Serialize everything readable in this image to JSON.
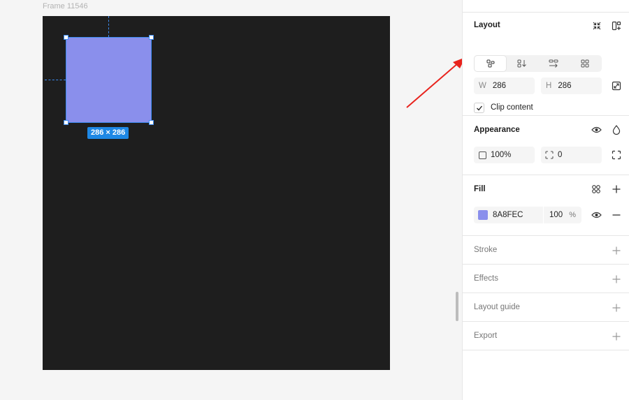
{
  "canvas": {
    "frame_label": "Frame 11546",
    "size_badge": "286 × 286",
    "shape_color": "#8a8fec",
    "selection_color": "#3d8bf0"
  },
  "panel": {
    "layout": {
      "title": "Layout",
      "width_label": "W",
      "width_value": "286",
      "height_label": "H",
      "height_value": "286",
      "clip_content_label": "Clip content",
      "clip_content_checked": true
    },
    "appearance": {
      "title": "Appearance",
      "opacity": "100%",
      "corner_radius": "0"
    },
    "fill": {
      "title": "Fill",
      "hex": "8A8FEC",
      "opacity": "100",
      "opacity_unit": "%",
      "color": "#8a8fec"
    },
    "stroke": {
      "title": "Stroke"
    },
    "effects": {
      "title": "Effects"
    },
    "layout_guide": {
      "title": "Layout guide"
    },
    "export": {
      "title": "Export"
    }
  },
  "annotation": {
    "arrow_color": "#e8231d"
  }
}
